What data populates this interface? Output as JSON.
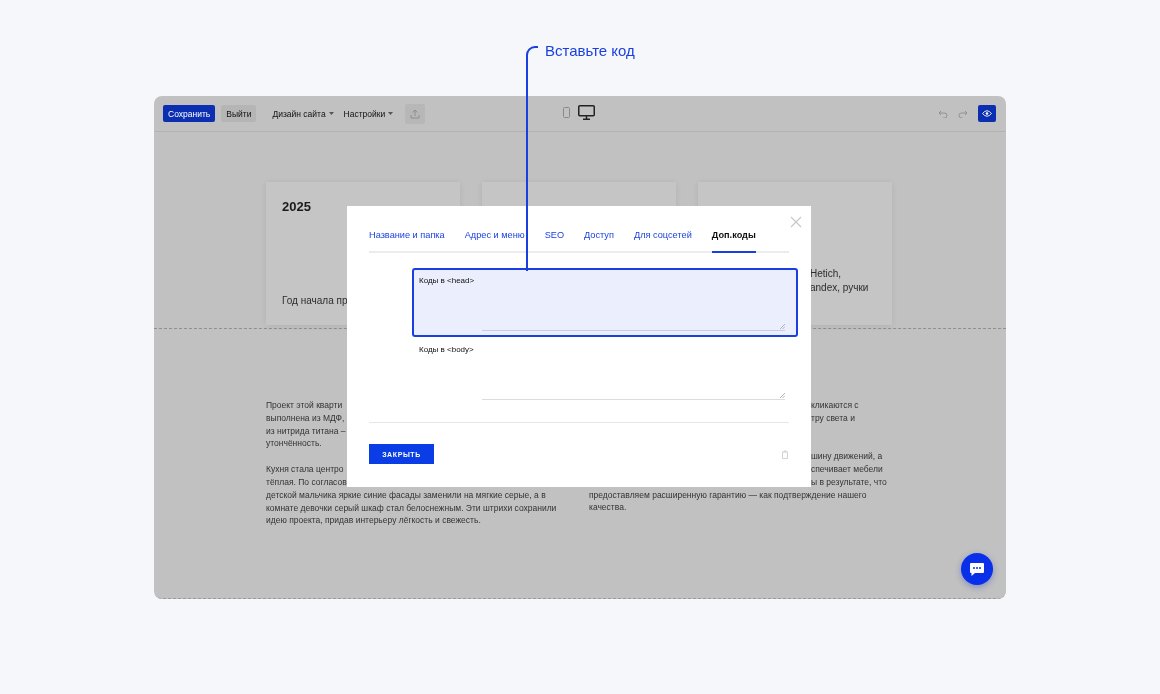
{
  "annotation": {
    "label": "Вставьте код"
  },
  "toolbar": {
    "save_button": "Сохранить",
    "exit_button": "Выйти",
    "menus": [
      "Дизайн сайта",
      "Настройки"
    ],
    "devices": [
      {
        "kind": "phone",
        "selected": false
      },
      {
        "kind": "desktop",
        "selected": true
      }
    ],
    "preview": {
      "on": true
    }
  },
  "cards": [
    {
      "kind": "info",
      "title": "2025",
      "lines": [
        "Год начала пр"
      ]
    },
    {
      "kind": "info"
    },
    {
      "kind": "info",
      "lines_right_of_dialog": [
        "Hetich,",
        "andex, ручки"
      ]
    }
  ],
  "columns": [
    {
      "paragraphs": [
        {
          "lines": [
            "Проект этой кварти",
            "выполнена из МДФ,",
            "из нитрида титана –",
            "утончённость."
          ]
        },
        {
          "lines": [
            "Кухня стала центро",
            "тёплая. По согласов",
            "детской мальчика яркие синие фасады заменили на мягкие серые, а в",
            "комнате девочки серый шкаф стал белоснежным. Эти штрихи сохранили",
            "идею проекта, придав интерьеру лёгкость и свежесть."
          ]
        }
      ]
    },
    {
      "paragraphs": [
        {
          "lines_right_of_dialog": [
            "кликаются с",
            "тру света и"
          ]
        },
        {
          "lines_right_of_dialog": [
            "шину движений, а",
            "спечивает мебели",
            "ы в результате, что"
          ],
          "lines": [
            "предоставляем расширенную гарантию — как подтверждение нашего",
            "качества."
          ]
        }
      ]
    }
  ],
  "modal": {
    "tabs": [
      {
        "label": "Название и папка",
        "selected": false
      },
      {
        "label": "Адрес и меню",
        "selected": false
      },
      {
        "label": "SEO",
        "selected": false
      },
      {
        "label": "Доступ",
        "selected": false
      },
      {
        "label": "Для соцсетей",
        "selected": false
      },
      {
        "label": "Доп.коды",
        "selected": true
      }
    ],
    "fields": [
      {
        "label": "Коды в <head>",
        "focused": true
      },
      {
        "label": "Коды в <body>",
        "focused": false
      }
    ],
    "close_button": "ЗАКРЫТЬ"
  }
}
